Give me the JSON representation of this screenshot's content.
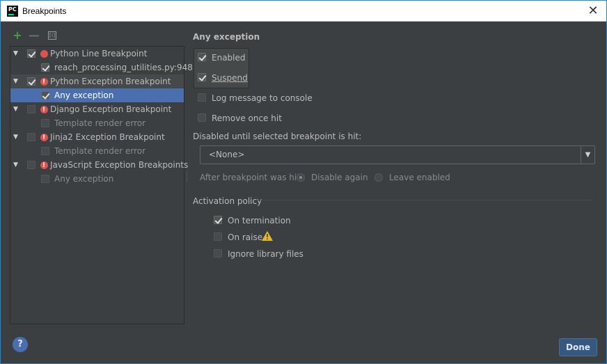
{
  "window": {
    "title": "Breakpoints",
    "app_icon": "PC",
    "close_glyph": "✕"
  },
  "toolbar": {
    "add_glyph": "+",
    "remove_glyph": "—",
    "group_glyph": "[i]"
  },
  "tree": [
    {
      "label": "Python Line Breakpoint",
      "checked": true,
      "icon": "red-dot",
      "children": [
        {
          "label": "reach_processing_utilities.py:948",
          "checked": true
        }
      ]
    },
    {
      "label": "Python Exception Breakpoint",
      "checked": true,
      "icon": "exception",
      "children": [
        {
          "label": "Any exception",
          "checked": true,
          "selected": true
        }
      ]
    },
    {
      "label": "Django Exception Breakpoint",
      "checked": false,
      "icon": "exception",
      "children": [
        {
          "label": "Template render error",
          "checked": false
        }
      ]
    },
    {
      "label": "Jinja2 Exception Breakpoint",
      "checked": false,
      "icon": "exception",
      "children": [
        {
          "label": "Template render error",
          "checked": false
        }
      ]
    },
    {
      "label": "JavaScript Exception Breakpoints",
      "checked": false,
      "icon": "exception",
      "children": [
        {
          "label": "Any exception",
          "checked": false
        }
      ]
    }
  ],
  "details": {
    "title": "Any exception",
    "enabled_label": "Enabled",
    "suspend_label": "Suspend",
    "log_message_label": "Log message to console",
    "remove_once_hit_label": "Remove once hit",
    "disabled_until_label": "Disabled until selected breakpoint is hit:",
    "disabled_until_value": "<None>",
    "after_hit_label": "After breakpoint was hit",
    "disable_again_label": "Disable again",
    "leave_enabled_label": "Leave enabled",
    "activation_policy_label": "Activation policy",
    "on_termination_label": "On termination",
    "on_raise_label": "On raise",
    "ignore_library_label": "Ignore library files"
  },
  "footer": {
    "help_glyph": "?",
    "done_label": "Done"
  },
  "colors": {
    "selection": "#4b6eaf",
    "accent_green": "#43a047",
    "breakpoint_red": "#d9534f",
    "warning": "#e5b82b"
  }
}
